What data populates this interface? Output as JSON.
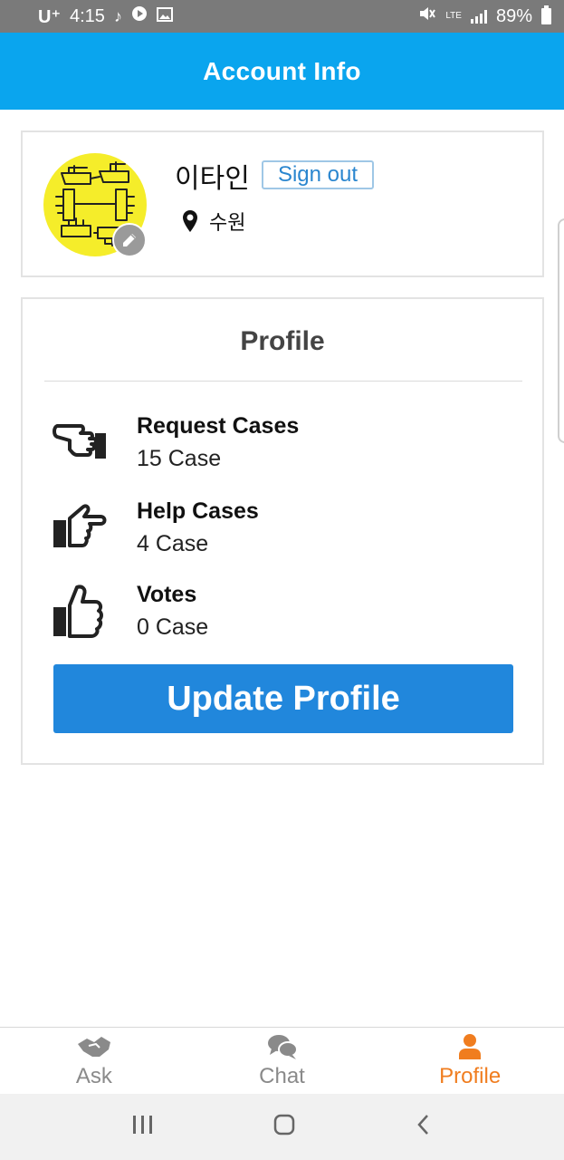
{
  "status_bar": {
    "carrier": "U⁺",
    "time": "4:15",
    "network": "LTE",
    "battery": "89%"
  },
  "header": {
    "title": "Account Info"
  },
  "user": {
    "name": "이타인",
    "sign_out_label": "Sign out",
    "location": "수원",
    "avatar_color": "#f5ed2a"
  },
  "profile": {
    "title": "Profile",
    "stats": [
      {
        "label": "Request Cases",
        "value": "15 Case",
        "icon": "hand-point-left-icon"
      },
      {
        "label": "Help Cases",
        "value": "4 Case",
        "icon": "hand-point-right-icon"
      },
      {
        "label": "Votes",
        "value": "0 Case",
        "icon": "thumbs-up-icon"
      }
    ],
    "update_label": "Update Profile"
  },
  "tabs": [
    {
      "label": "Ask",
      "icon": "handshake-icon",
      "active": false
    },
    {
      "label": "Chat",
      "icon": "chat-bubbles-icon",
      "active": false
    },
    {
      "label": "Profile",
      "icon": "person-icon",
      "active": true
    }
  ],
  "colors": {
    "header_bg": "#0aa5ee",
    "primary_button": "#2187dc",
    "active_tab": "#f07d1f",
    "inactive_tab": "#8a8a8a"
  }
}
